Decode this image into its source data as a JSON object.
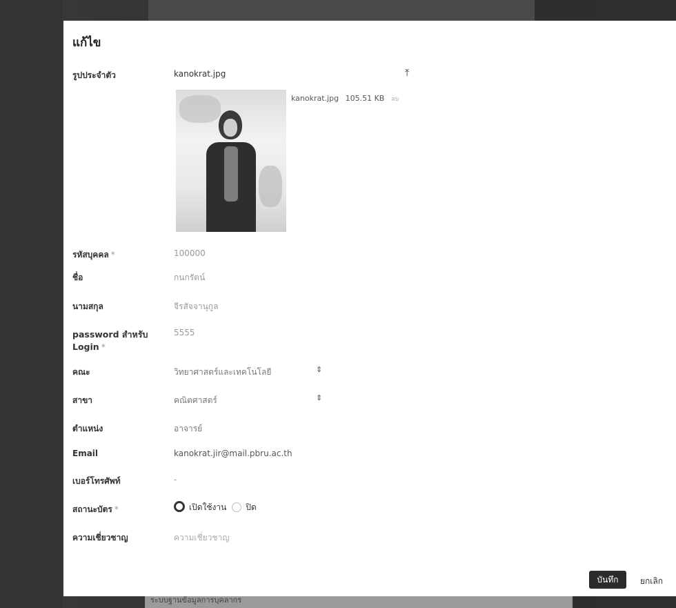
{
  "backdrop": {
    "bottom_text": "ระบบฐานข้อมูลการบุคลากร"
  },
  "modal": {
    "title": "แก้ไข",
    "save_label": "บันทึก",
    "cancel_label": "ยกเลิก"
  },
  "form": {
    "photo": {
      "label": "รูปประจำตัว",
      "filename": "kanokrat.jpg",
      "meta_name": "kanokrat.jpg",
      "meta_size": "105.51 KB",
      "meta_extra": "ลบ"
    },
    "staff_id": {
      "label": "รหัสบุคคล",
      "required": "*",
      "value": "100000"
    },
    "first_name": {
      "label": "ชื่อ",
      "value": "กนกรัตน์"
    },
    "last_name": {
      "label": "นามสกุล",
      "value": "จีรสัจจานุกูล"
    },
    "password": {
      "label": "password สำหรับ Login",
      "required": "*",
      "value": "5555"
    },
    "faculty": {
      "label": "คณะ",
      "value": "วิทยาศาสตร์และเทคโนโลยี"
    },
    "major": {
      "label": "สาขา",
      "value": "คณิตศาสตร์"
    },
    "position": {
      "label": "ตำแหน่ง",
      "value": "อาจารย์"
    },
    "email": {
      "label": "Email",
      "value": "kanokrat.jir@mail.pbru.ac.th"
    },
    "phone": {
      "label": "เบอร์โทรศัพท์",
      "value": "-"
    },
    "status": {
      "label": "สถานะบัตร",
      "required": "*",
      "option_on": "เปิดใช้งาน",
      "option_off": "ปิด"
    },
    "expertise": {
      "label": "ความเชี่ยวชาญ",
      "placeholder": "ความเชี่ยวชาญ"
    }
  },
  "icons": {
    "upload": "upload-icon",
    "select": "select-arrows-icon",
    "status_selected": "radio-checked"
  }
}
